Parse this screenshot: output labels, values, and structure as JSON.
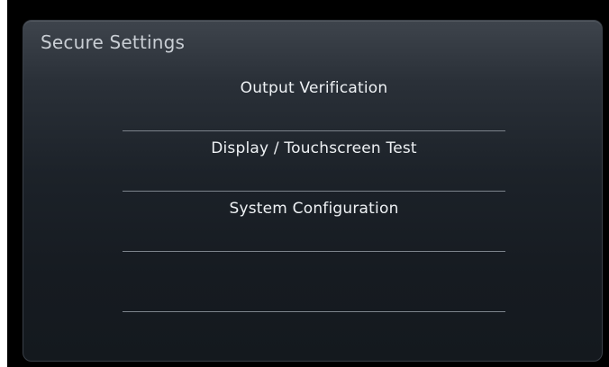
{
  "panel": {
    "title": "Secure Settings"
  },
  "menu": {
    "items": [
      {
        "label": "Output Verification"
      },
      {
        "label": "Display / Touchscreen Test"
      },
      {
        "label": "System Configuration"
      },
      {
        "label": ""
      }
    ]
  },
  "colors": {
    "panel_bg_top": "#3e444c",
    "panel_bg_bottom": "#14191e",
    "text": "#eef1f4",
    "title_text": "#c9ced4",
    "separator": "#7c838b"
  }
}
